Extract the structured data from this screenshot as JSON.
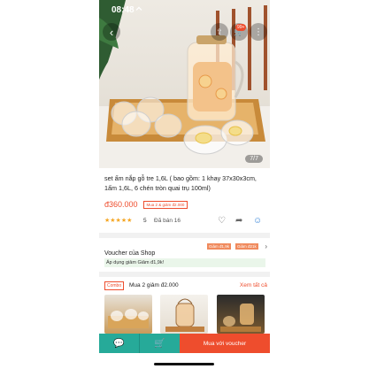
{
  "status": {
    "time": "08:48"
  },
  "hero": {
    "image_counter": "7/7",
    "cart_badge": "99+"
  },
  "product": {
    "title": "set ấm nắp gỗ tre 1,6L ( bao gồm: 1 khay 37x30x3cm, 1ấm 1,6L, 6 chén tròn quai trụ 100ml)",
    "price": "đ360.000",
    "promo": "Mua 2 & giảm đ2.000",
    "rating": "5",
    "sold": "Đã bán 16"
  },
  "voucher": {
    "title": "Voucher của Shop",
    "tags": [
      "Giảm đ1,9k",
      "Giảm đ21k"
    ],
    "applied": "Áp dụng giảm Giảm đ1,9k!"
  },
  "combo": {
    "tag": "Combo",
    "title": "Mua 2 giảm đ2.000",
    "see_all": "Xem tất cả"
  },
  "bottom": {
    "buy_label": "Mua với voucher"
  },
  "icons": [
    "back-icon",
    "share-icon",
    "cart-icon",
    "more-icon",
    "heart-icon",
    "chat-icon"
  ],
  "colors": {
    "brand": "#ee4d2d",
    "chat": "#26aa99",
    "star": "#f5a623"
  }
}
